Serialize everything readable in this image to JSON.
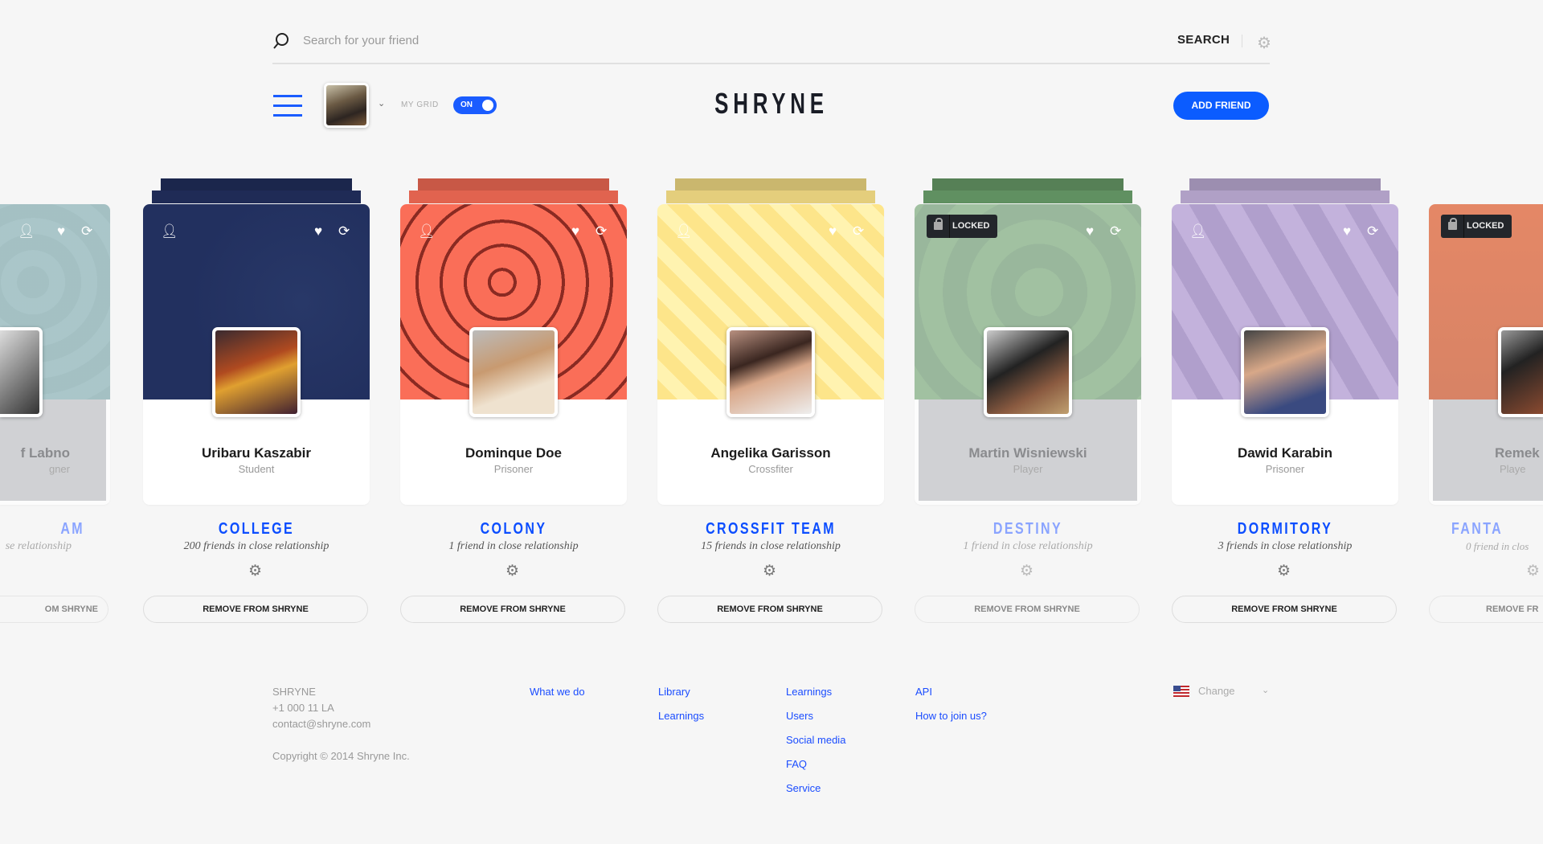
{
  "search": {
    "placeholder": "Search for your friend",
    "button": "SEARCH",
    "icon": "search-icon",
    "settings_icon": "gear-icon"
  },
  "header": {
    "logo": "SHRYNE",
    "my_grid": "MY GRID",
    "toggle": "ON",
    "toggle_on": true,
    "add_friend": "ADD FRIEND"
  },
  "colors": {
    "accent": "#0b5cff",
    "title": "#0b4dff",
    "faded_title": "#8aa4ff"
  },
  "cards": [
    {
      "name": "f Labno",
      "role": "gner",
      "group": "AM",
      "subtitle": "se relationship",
      "button": "OM SHRYNE",
      "faded": true,
      "locked": false,
      "bg": "#6f9ea3"
    },
    {
      "name": "Uribaru Kaszabir",
      "role": "Student",
      "group": "COLLEGE",
      "subtitle": "200 friends in close relationship",
      "button": "REMOVE FROM SHRYNE",
      "faded": false,
      "locked": false,
      "bg": "#22305f"
    },
    {
      "name": "Dominque Doe",
      "role": "Prisoner",
      "group": "COLONY",
      "subtitle": "1 friend in close relationship",
      "button": "REMOVE FROM SHRYNE",
      "faded": false,
      "locked": false,
      "bg": "#fa6e58"
    },
    {
      "name": "Angelika Garisson",
      "role": "Crossfiter",
      "group": "CROSSFIT TEAM",
      "subtitle": "15 friends in close relationship",
      "button": "REMOVE FROM SHRYNE",
      "faded": false,
      "locked": false,
      "bg": "#fde58a"
    },
    {
      "name": "Martin Wisniewski",
      "role": "Player",
      "group": "DESTINY",
      "subtitle": "1 friend in close relationship",
      "button": "REMOVE FROM SHRYNE",
      "faded": true,
      "locked": true,
      "bg": "#6ba06c"
    },
    {
      "name": "Dawid Karabin",
      "role": "Prisoner",
      "group": "DORMITORY",
      "subtitle": "3 friends in close relationship",
      "button": "REMOVE FROM SHRYNE",
      "faded": false,
      "locked": false,
      "bg": "#c3b2dc"
    },
    {
      "name": "Remek",
      "role": "Playe",
      "group": "FANTA",
      "subtitle": "0 friend in clos",
      "button": "REMOVE FR",
      "faded": true,
      "locked": true,
      "bg": "#d9420c"
    }
  ],
  "locked_label": "LOCKED",
  "footer": {
    "company": "SHRYNE",
    "phone": "+1 000 11 LA",
    "email": "contact@shryne.com",
    "copyright": "Copyright © 2014 Shryne Inc.",
    "col1": [
      "What we do"
    ],
    "col2": [
      "Library",
      "Learnings"
    ],
    "col3": [
      "Learnings",
      "Users",
      "Social media",
      "FAQ",
      "Service"
    ],
    "col4": [
      "API",
      "How to join us?"
    ],
    "language": "Change",
    "flag_icon": "us-flag-icon"
  }
}
